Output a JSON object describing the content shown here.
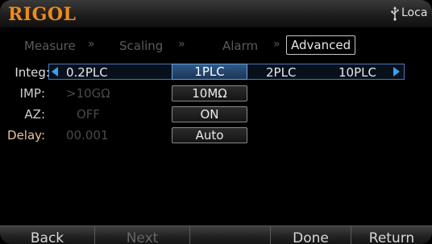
{
  "header": {
    "logo": "RIGOL",
    "status_text": "Loca",
    "usb_icon": "usb-icon",
    "accent_color": "#f08a18"
  },
  "breadcrumb": {
    "items": [
      "Measure",
      "Scaling",
      "Alarm",
      "Advanced"
    ],
    "active_index": 3,
    "separator_icon": "double-chevron-right"
  },
  "rows": {
    "integ": {
      "label": "Integ:",
      "options": [
        "0.2PLC",
        "1PLC",
        "2PLC",
        "10PLC"
      ],
      "selected": "1PLC"
    },
    "imp": {
      "label": "IMP:",
      "options": [
        ">10GΩ",
        "10MΩ"
      ],
      "selected": "10MΩ"
    },
    "az": {
      "label": "AZ:",
      "options": [
        "OFF",
        "ON"
      ],
      "selected": "ON"
    },
    "delay": {
      "label": "Delay:",
      "value": "00.001",
      "button": "Auto"
    }
  },
  "softkeys": [
    {
      "label": "Back",
      "enabled": true
    },
    {
      "label": "Next",
      "enabled": false
    },
    {
      "label": "",
      "enabled": false
    },
    {
      "label": "Done",
      "enabled": true
    },
    {
      "label": "Return",
      "enabled": true
    }
  ]
}
